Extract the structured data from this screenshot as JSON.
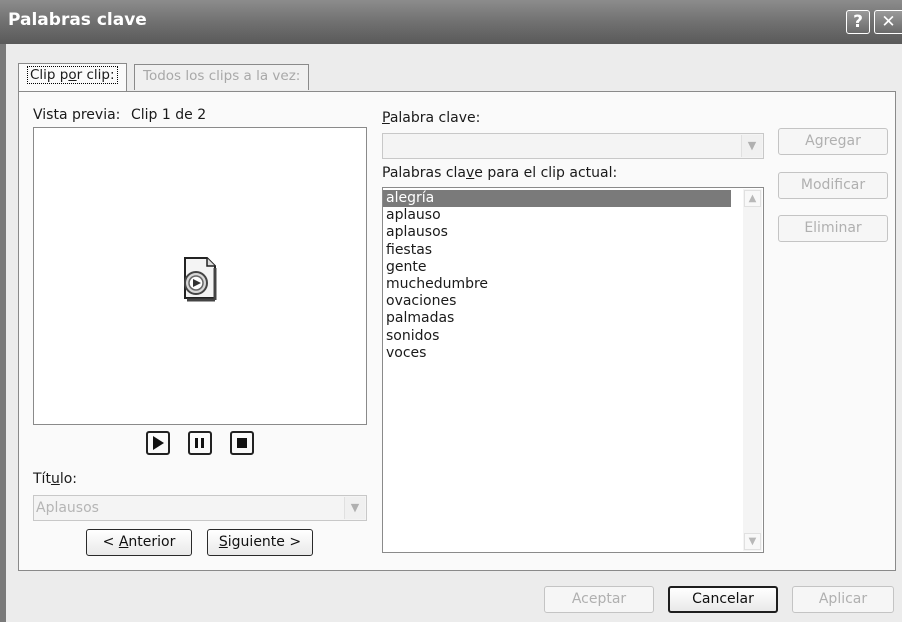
{
  "window": {
    "title": "Palabras clave"
  },
  "titlebar": {
    "help_label": "?",
    "close_label": "✕"
  },
  "tabs": [
    {
      "label": "Clip por clip:"
    },
    {
      "label": "Todos los clips a la vez:"
    }
  ],
  "preview": {
    "label": "Vista previa:",
    "clip_status": "Clip 1 de 2",
    "media_icon": "sound-clip-icon",
    "controls": [
      "play-icon",
      "pause-icon",
      "stop-icon"
    ]
  },
  "title_field": {
    "label": "Título:",
    "value": "Aplausos"
  },
  "nav": {
    "prev_label": "< Anterior",
    "next_label": "Siguiente >"
  },
  "keyword": {
    "label": "Palabra clave:",
    "value": ""
  },
  "current_keywords": {
    "label": "Palabras clave para el clip actual:",
    "items": [
      "alegría",
      "aplauso",
      "aplausos",
      "fiestas",
      "gente",
      "muchedumbre",
      "ovaciones",
      "palmadas",
      "sonidos",
      "voces"
    ],
    "selected_index": 0
  },
  "side_buttons": {
    "add": "Agregar",
    "modify": "Modificar",
    "delete": "Eliminar"
  },
  "footer": {
    "ok": "Aceptar",
    "cancel": "Cancelar",
    "apply": "Aplicar"
  }
}
